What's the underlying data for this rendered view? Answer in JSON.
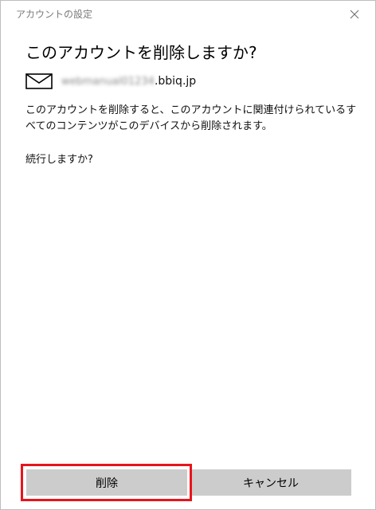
{
  "window": {
    "title": "アカウントの設定"
  },
  "dialog": {
    "heading": "このアカウントを削除しますか?",
    "account": {
      "icon": "mail-icon",
      "email_hidden": "webmanual01234",
      "email_domain": ".bbiq.jp"
    },
    "message": "このアカウントを削除すると、このアカウントに関連付けられているすべてのコンテンツがこのデバイスから削除されます。",
    "confirm_question": "続行しますか?"
  },
  "buttons": {
    "delete_label": "削除",
    "cancel_label": "キャンセル"
  },
  "colors": {
    "highlight": "#e8141c",
    "button_bg": "#cccccc",
    "title_text": "#7a7a7a"
  }
}
